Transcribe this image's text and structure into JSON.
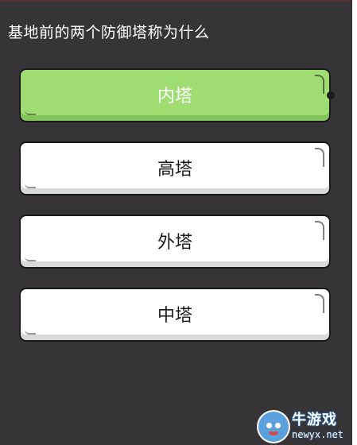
{
  "question": "基地前的两个防御塔称为什么",
  "options": [
    {
      "label": "内塔",
      "selected": true
    },
    {
      "label": "高塔",
      "selected": false
    },
    {
      "label": "外塔",
      "selected": false
    },
    {
      "label": "中塔",
      "selected": false
    }
  ],
  "watermark": {
    "brand": "牛游戏",
    "domain": "newyx.net"
  },
  "colors": {
    "background": "#373438",
    "selected_option": "#9fdd73",
    "option": "#ffffff"
  }
}
